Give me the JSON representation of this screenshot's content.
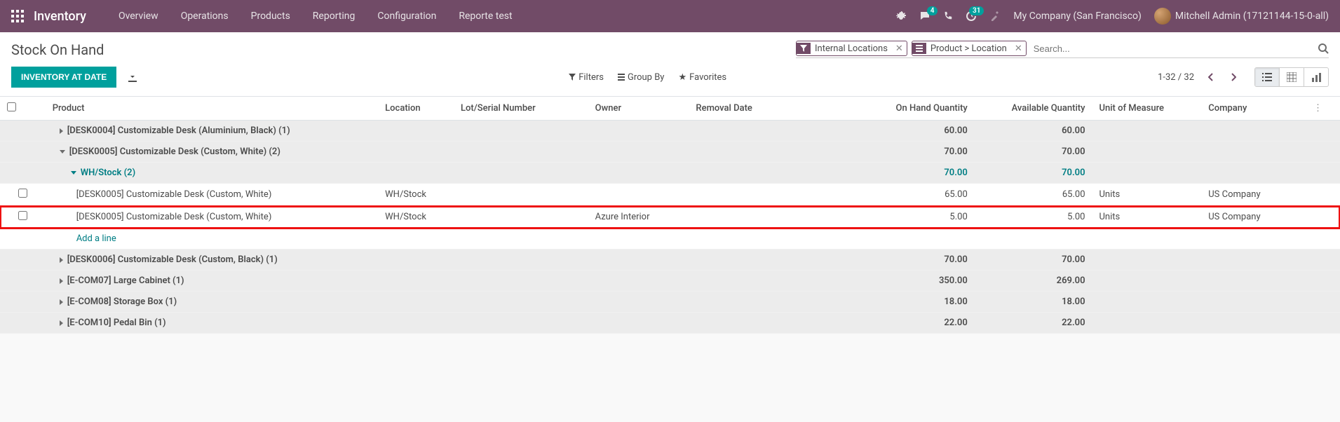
{
  "nav": {
    "app": "Inventory",
    "menu": [
      "Overview",
      "Operations",
      "Products",
      "Reporting",
      "Configuration",
      "Reporte test"
    ],
    "messages_badge": "4",
    "activities_badge": "31",
    "company": "My Company (San Francisco)",
    "user": "Mitchell Admin (17121144-15-0-all)"
  },
  "page": {
    "title": "Stock On Hand",
    "primary_btn": "Inventory at Date"
  },
  "search": {
    "facets": [
      {
        "icon": "filter",
        "label": "Internal Locations"
      },
      {
        "icon": "groupby",
        "label": "Product > Location"
      }
    ],
    "placeholder": "Search..."
  },
  "toolbar": {
    "filters": "Filters",
    "groupby": "Group By",
    "favorites": "Favorites",
    "pager": "1-32 / 32"
  },
  "columns": {
    "product": "Product",
    "location": "Location",
    "lot": "Lot/Serial Number",
    "owner": "Owner",
    "removal": "Removal Date",
    "onhand": "On Hand Quantity",
    "available": "Available Quantity",
    "uom": "Unit of Measure",
    "company": "Company"
  },
  "rows": {
    "g0": {
      "label": "[DESK0004] Customizable Desk (Aluminium, Black) (1)",
      "onhand": "60.00",
      "available": "60.00"
    },
    "g1": {
      "label": "[DESK0005] Customizable Desk (Custom, White) (2)",
      "onhand": "70.00",
      "available": "70.00"
    },
    "g1_loc": {
      "label": "WH/Stock (2)",
      "onhand": "70.00",
      "available": "70.00"
    },
    "r1": {
      "product": "[DESK0005] Customizable Desk (Custom, White)",
      "location": "WH/Stock",
      "owner": "",
      "onhand": "65.00",
      "available": "65.00",
      "uom": "Units",
      "company": "US Company"
    },
    "r2": {
      "product": "[DESK0005] Customizable Desk (Custom, White)",
      "location": "WH/Stock",
      "owner": "Azure Interior",
      "onhand": "5.00",
      "available": "5.00",
      "uom": "Units",
      "company": "US Company"
    },
    "add": "Add a line",
    "g2": {
      "label": "[DESK0006] Customizable Desk (Custom, Black) (1)",
      "onhand": "70.00",
      "available": "70.00"
    },
    "g3": {
      "label": "[E-COM07] Large Cabinet (1)",
      "onhand": "350.00",
      "available": "269.00"
    },
    "g4": {
      "label": "[E-COM08] Storage Box (1)",
      "onhand": "18.00",
      "available": "18.00"
    },
    "g5": {
      "label": "[E-COM10] Pedal Bin (1)",
      "onhand": "22.00",
      "available": "22.00"
    }
  }
}
